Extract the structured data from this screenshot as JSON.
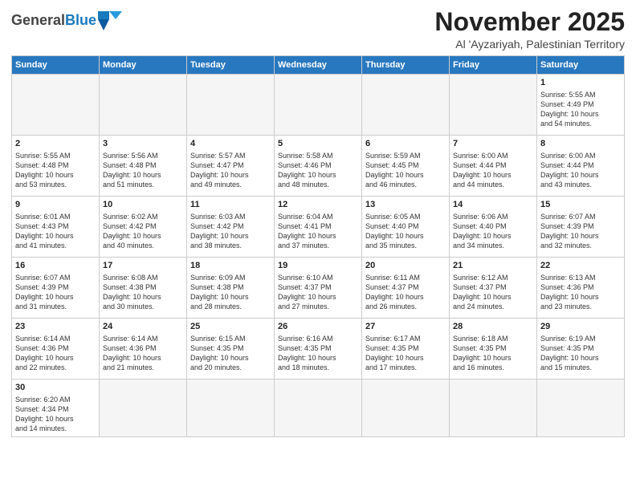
{
  "header": {
    "logo_general": "General",
    "logo_blue": "Blue",
    "month_title": "November 2025",
    "subtitle": "Al 'Ayzariyah, Palestinian Territory"
  },
  "weekdays": [
    "Sunday",
    "Monday",
    "Tuesday",
    "Wednesday",
    "Thursday",
    "Friday",
    "Saturday"
  ],
  "weeks": [
    [
      {
        "day": "",
        "empty": true
      },
      {
        "day": "",
        "empty": true
      },
      {
        "day": "",
        "empty": true
      },
      {
        "day": "",
        "empty": true
      },
      {
        "day": "",
        "empty": true
      },
      {
        "day": "",
        "empty": true
      },
      {
        "day": "1",
        "info": "Sunrise: 5:55 AM\nSunset: 4:49 PM\nDaylight: 10 hours\nand 54 minutes."
      }
    ],
    [
      {
        "day": "2",
        "info": "Sunrise: 5:55 AM\nSunset: 4:48 PM\nDaylight: 10 hours\nand 53 minutes."
      },
      {
        "day": "3",
        "info": "Sunrise: 5:56 AM\nSunset: 4:48 PM\nDaylight: 10 hours\nand 51 minutes."
      },
      {
        "day": "4",
        "info": "Sunrise: 5:57 AM\nSunset: 4:47 PM\nDaylight: 10 hours\nand 49 minutes."
      },
      {
        "day": "5",
        "info": "Sunrise: 5:58 AM\nSunset: 4:46 PM\nDaylight: 10 hours\nand 48 minutes."
      },
      {
        "day": "6",
        "info": "Sunrise: 5:59 AM\nSunset: 4:45 PM\nDaylight: 10 hours\nand 46 minutes."
      },
      {
        "day": "7",
        "info": "Sunrise: 6:00 AM\nSunset: 4:44 PM\nDaylight: 10 hours\nand 44 minutes."
      },
      {
        "day": "8",
        "info": "Sunrise: 6:00 AM\nSunset: 4:44 PM\nDaylight: 10 hours\nand 43 minutes."
      }
    ],
    [
      {
        "day": "9",
        "info": "Sunrise: 6:01 AM\nSunset: 4:43 PM\nDaylight: 10 hours\nand 41 minutes."
      },
      {
        "day": "10",
        "info": "Sunrise: 6:02 AM\nSunset: 4:42 PM\nDaylight: 10 hours\nand 40 minutes."
      },
      {
        "day": "11",
        "info": "Sunrise: 6:03 AM\nSunset: 4:42 PM\nDaylight: 10 hours\nand 38 minutes."
      },
      {
        "day": "12",
        "info": "Sunrise: 6:04 AM\nSunset: 4:41 PM\nDaylight: 10 hours\nand 37 minutes."
      },
      {
        "day": "13",
        "info": "Sunrise: 6:05 AM\nSunset: 4:40 PM\nDaylight: 10 hours\nand 35 minutes."
      },
      {
        "day": "14",
        "info": "Sunrise: 6:06 AM\nSunset: 4:40 PM\nDaylight: 10 hours\nand 34 minutes."
      },
      {
        "day": "15",
        "info": "Sunrise: 6:07 AM\nSunset: 4:39 PM\nDaylight: 10 hours\nand 32 minutes."
      }
    ],
    [
      {
        "day": "16",
        "info": "Sunrise: 6:07 AM\nSunset: 4:39 PM\nDaylight: 10 hours\nand 31 minutes."
      },
      {
        "day": "17",
        "info": "Sunrise: 6:08 AM\nSunset: 4:38 PM\nDaylight: 10 hours\nand 30 minutes."
      },
      {
        "day": "18",
        "info": "Sunrise: 6:09 AM\nSunset: 4:38 PM\nDaylight: 10 hours\nand 28 minutes."
      },
      {
        "day": "19",
        "info": "Sunrise: 6:10 AM\nSunset: 4:37 PM\nDaylight: 10 hours\nand 27 minutes."
      },
      {
        "day": "20",
        "info": "Sunrise: 6:11 AM\nSunset: 4:37 PM\nDaylight: 10 hours\nand 26 minutes."
      },
      {
        "day": "21",
        "info": "Sunrise: 6:12 AM\nSunset: 4:37 PM\nDaylight: 10 hours\nand 24 minutes."
      },
      {
        "day": "22",
        "info": "Sunrise: 6:13 AM\nSunset: 4:36 PM\nDaylight: 10 hours\nand 23 minutes."
      }
    ],
    [
      {
        "day": "23",
        "info": "Sunrise: 6:14 AM\nSunset: 4:36 PM\nDaylight: 10 hours\nand 22 minutes."
      },
      {
        "day": "24",
        "info": "Sunrise: 6:14 AM\nSunset: 4:36 PM\nDaylight: 10 hours\nand 21 minutes."
      },
      {
        "day": "25",
        "info": "Sunrise: 6:15 AM\nSunset: 4:35 PM\nDaylight: 10 hours\nand 20 minutes."
      },
      {
        "day": "26",
        "info": "Sunrise: 6:16 AM\nSunset: 4:35 PM\nDaylight: 10 hours\nand 18 minutes."
      },
      {
        "day": "27",
        "info": "Sunrise: 6:17 AM\nSunset: 4:35 PM\nDaylight: 10 hours\nand 17 minutes."
      },
      {
        "day": "28",
        "info": "Sunrise: 6:18 AM\nSunset: 4:35 PM\nDaylight: 10 hours\nand 16 minutes."
      },
      {
        "day": "29",
        "info": "Sunrise: 6:19 AM\nSunset: 4:35 PM\nDaylight: 10 hours\nand 15 minutes."
      }
    ],
    [
      {
        "day": "30",
        "info": "Sunrise: 6:20 AM\nSunset: 4:34 PM\nDaylight: 10 hours\nand 14 minutes.",
        "last": true
      },
      {
        "day": "",
        "empty": true,
        "last": true
      },
      {
        "day": "",
        "empty": true,
        "last": true
      },
      {
        "day": "",
        "empty": true,
        "last": true
      },
      {
        "day": "",
        "empty": true,
        "last": true
      },
      {
        "day": "",
        "empty": true,
        "last": true
      },
      {
        "day": "",
        "empty": true,
        "last": true
      }
    ]
  ]
}
